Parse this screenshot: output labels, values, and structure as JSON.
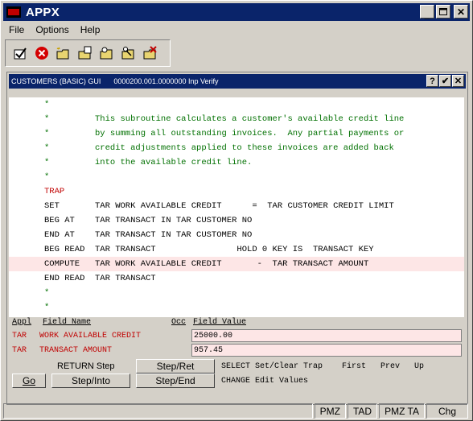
{
  "window": {
    "title": "APPX"
  },
  "menu": [
    "File",
    "Options",
    "Help"
  ],
  "toolbar": [
    {
      "icon": "check-icon"
    },
    {
      "icon": "cancel-icon"
    },
    {
      "icon": "new-folder-icon"
    },
    {
      "icon": "folder-edit-icon"
    },
    {
      "icon": "folder-search-icon"
    },
    {
      "icon": "folder-key-icon"
    },
    {
      "icon": "folder-delete-icon"
    }
  ],
  "inner": {
    "title": "CUSTOMERS (BASIC) GUI",
    "mode": "0000200.001.0000000 Inp Verify",
    "help_label": "?",
    "ok_label": "✔",
    "close_label": "✕"
  },
  "code": [
    {
      "op": "*",
      "text": "",
      "color": "green"
    },
    {
      "op": "*",
      "text": "This subroutine calculates a customer's available credit line",
      "color": "green"
    },
    {
      "op": "*",
      "text": "by summing all outstanding invoices.  Any partial payments or",
      "color": "green"
    },
    {
      "op": "*",
      "text": "credit adjustments applied to these invoices are added back",
      "color": "green"
    },
    {
      "op": "*",
      "text": "into the available credit line.",
      "color": "green"
    },
    {
      "op": "*",
      "text": "",
      "color": "green"
    },
    {
      "op": "TRAP",
      "text": "",
      "color": "red"
    },
    {
      "op": "SET",
      "text": "TAR WORK AVAILABLE CREDIT      =  TAR CUSTOMER CREDIT LIMIT",
      "color": "black"
    },
    {
      "op": "BEG AT",
      "text": "TAR TRANSACT IN TAR CUSTOMER NO",
      "color": "black"
    },
    {
      "op": "END AT",
      "text": "TAR TRANSACT IN TAR CUSTOMER NO",
      "color": "black"
    },
    {
      "op": "BEG READ",
      "text": "TAR TRANSACT                HOLD 0 KEY IS  TRANSACT KEY",
      "color": "black"
    },
    {
      "op": "COMPUTE",
      "text": "TAR WORK AVAILABLE CREDIT       -  TAR TRANSACT AMOUNT",
      "color": "black",
      "highlight": true
    },
    {
      "op": "END READ",
      "text": "TAR TRANSACT",
      "color": "black"
    },
    {
      "op": "*",
      "text": "",
      "color": "green"
    },
    {
      "op": "*",
      "text": "",
      "color": "green"
    }
  ],
  "fields_header": {
    "appl": "Appl",
    "field_name": "Field Name",
    "occ": "Occ",
    "field_value": "Field Value"
  },
  "fields": [
    {
      "appl": "TAR",
      "name": "WORK AVAILABLE CREDIT",
      "value": "25000.00"
    },
    {
      "appl": "TAR",
      "name": "TRANSACT AMOUNT",
      "value": "957.45"
    }
  ],
  "controls": {
    "return_step": "RETURN Step",
    "step_ret": "Step/Ret",
    "go": "Go",
    "step_into": "Step/Into",
    "step_end": "Step/End"
  },
  "hints": {
    "line1": "SELECT Set/Clear Trap    First   Prev   Up",
    "line2": "CHANGE Edit Values"
  },
  "status": [
    "PMZ",
    "TAD",
    "PMZ TA",
    "Chg"
  ]
}
